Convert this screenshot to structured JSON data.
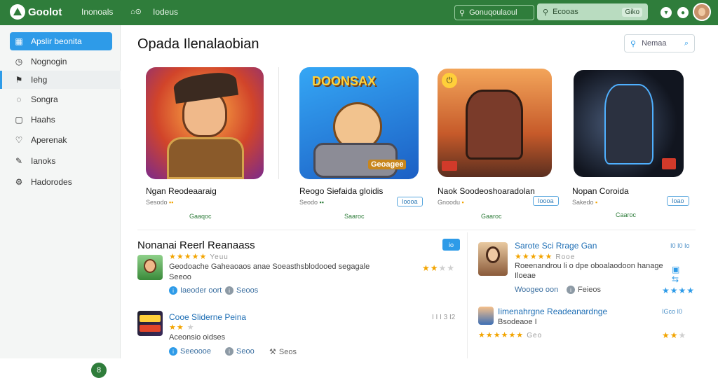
{
  "topbar": {
    "brand": "Goolot",
    "nav_1": "Inonoals",
    "nav_2": "Iodeus",
    "search_text": "Gonuqoulaoul",
    "search2_text": "Ecooas",
    "search2_kbd": "Giko",
    "accent": "#2f7d3b"
  },
  "sidebar": {
    "items": [
      {
        "label": "Apslir beonita",
        "icon": "grid-icon"
      },
      {
        "label": "Nognogin",
        "icon": "clock-icon"
      },
      {
        "label": "Iehg",
        "icon": "flag-icon"
      },
      {
        "label": "Songra",
        "icon": "chat-icon"
      },
      {
        "label": "Haahs",
        "icon": "document-icon"
      },
      {
        "label": "Aperenak",
        "icon": "heart-icon"
      },
      {
        "label": "Ianoks",
        "icon": "edit-icon"
      },
      {
        "label": "Hadorodes",
        "icon": "settings-icon"
      }
    ],
    "fab": "8"
  },
  "main": {
    "title": "Opada Ilenalaobian",
    "search_placeholder": "Nemaa"
  },
  "featured": [
    {
      "name": "Ngan Reodeaaraig",
      "meta": "Sesodo",
      "badge": "",
      "install": "Gaaqoc"
    },
    {
      "name": "Reogo Siefaida gloidis",
      "meta": "Seodo",
      "badge": "Ioooa",
      "install": "Saaroc"
    },
    {
      "name": "Naok Soodeoshoaradolan",
      "meta": "Gnoodu",
      "badge": "Ioooa",
      "install": "Gaaroc"
    },
    {
      "name": "Nopan Coroida",
      "meta": "Sakedo",
      "badge": "Ioao",
      "install": "Caaroc"
    }
  ],
  "featured_art_text": [
    "",
    "DOONSAX",
    "Geoagee",
    ""
  ],
  "section": {
    "title": "Nonanai Reerl Reanaass",
    "badge": "io"
  },
  "list_left": [
    {
      "title": "",
      "stars_label": "Yeuu",
      "desc": "Geodoache Gaheaoaos anae Soeasthsblodooed segagale",
      "sub": "Seeoo",
      "tag1": "Iaeoder oort",
      "tag2": "Seoos",
      "rating_label": "",
      "stars_on": 2,
      "stars_total": 5
    },
    {
      "title": "Cooe Sliderne Peina",
      "stars_label": "",
      "desc": "Aceonsio oidses",
      "sub": "",
      "tag1": "Seeoooe",
      "tag2": "Seoo",
      "tag3": "Seos",
      "rating_label": "I I I 3 I2",
      "stars_on": 0,
      "stars_total": 0
    }
  ],
  "list_right": [
    {
      "title": "Sarote Sci Rrage Gan",
      "stars_label": "Rooe",
      "desc": "Roeenandrou li o dpe oboalaodoon hanage",
      "sub": "Iloeae",
      "tag1": "Woogeo oon",
      "tag2": "Feieos",
      "note": "I0 I0 Io",
      "stars_on": 4,
      "stars_total": 4
    },
    {
      "title": "Iimenahrgne Readeanardnge",
      "stars_label": "Geo",
      "desc": "",
      "sub": "Bsodeaoe I",
      "tag1": "",
      "tag2": "",
      "note": "IGco I0",
      "stars_on": 2,
      "stars_total": 3
    }
  ]
}
